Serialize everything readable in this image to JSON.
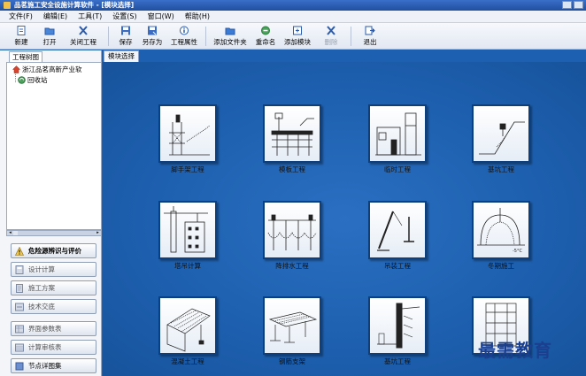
{
  "window": {
    "title": "品茗施工安全设施计算软件 - [模块选择]"
  },
  "menu": [
    "文件(F)",
    "编辑(E)",
    "工具(T)",
    "设置(S)",
    "窗口(W)",
    "帮助(H)"
  ],
  "toolbar": {
    "new": "新建",
    "open": "打开",
    "close_project": "关闭工程",
    "save": "保存",
    "save_as": "另存为",
    "project_props": "工程属性",
    "add_folder": "添加文件夹",
    "rename": "重命名",
    "add_module": "添加模块",
    "delete": "删除",
    "exit": "退出"
  },
  "left_panel": {
    "tab": "工程树图",
    "tree": [
      "浙江品茗高新产业软",
      "回收站"
    ],
    "accordion": [
      "危险源辨识与评价",
      "设计计算",
      "施工方案",
      "技术交底",
      "界面参数表",
      "计算审核表",
      "节点详图集"
    ]
  },
  "doc_tab": "模块选择",
  "modules": [
    "脚手架工程",
    "模板工程",
    "临时工程",
    "基坑工程",
    "塔吊计算",
    "降排水工程",
    "吊装工程",
    "冬期施工",
    "混凝土工程",
    "钢筋支架",
    "基坑工程",
    ""
  ],
  "watermark": "最需教育",
  "colors": {
    "workspace": "#1d5fb0",
    "module_border": "#0e3f7d"
  }
}
